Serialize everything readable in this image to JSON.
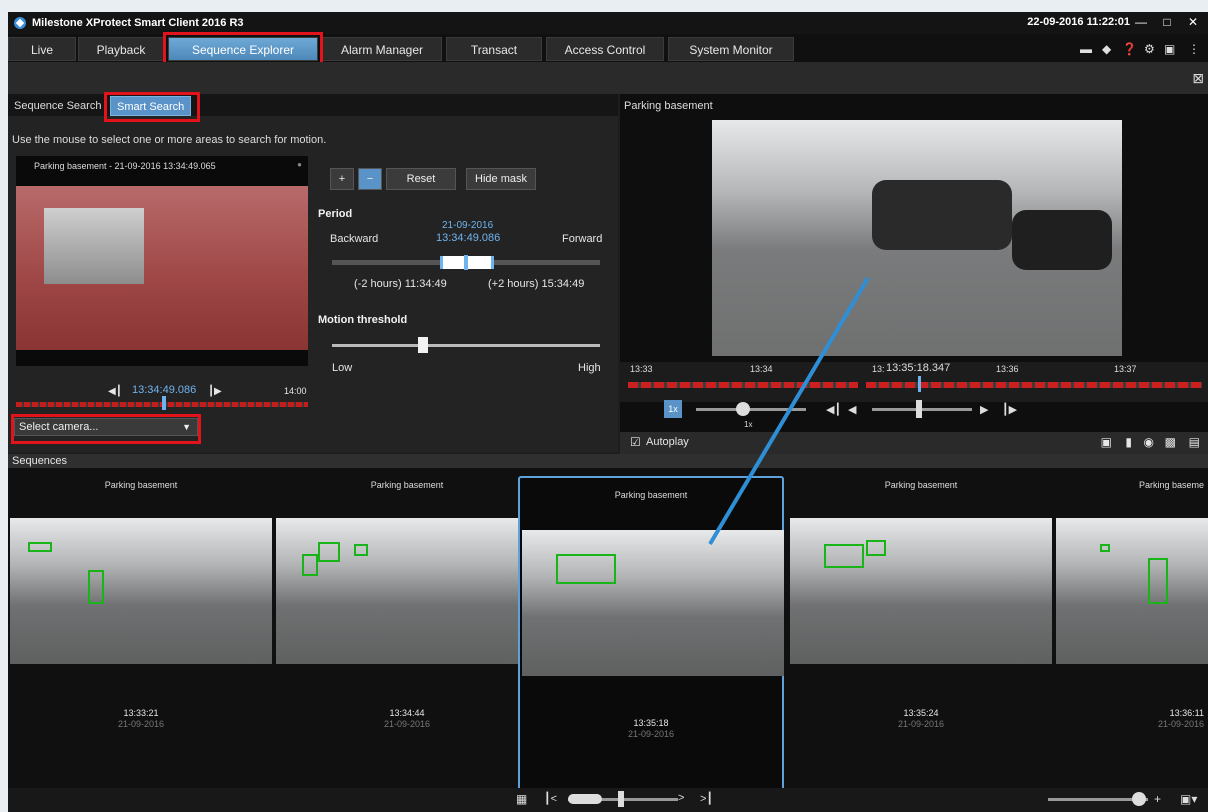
{
  "app": {
    "title": "Milestone XProtect Smart Client 2016 R3",
    "clock": "22-09-2016 11:22:01",
    "window_buttons": {
      "minimize": "—",
      "maximize": "□",
      "close": "✕"
    }
  },
  "tabs": [
    {
      "label": "Live"
    },
    {
      "label": "Playback"
    },
    {
      "label": "Sequence Explorer",
      "active": true
    },
    {
      "label": "Alarm Manager"
    },
    {
      "label": "Transact"
    },
    {
      "label": "Access Control"
    },
    {
      "label": "System Monitor"
    }
  ],
  "search": {
    "tabs": [
      {
        "label": "Sequence Search"
      },
      {
        "label": "Smart Search",
        "active": true
      }
    ],
    "hint": "Use the mouse to select one or more areas to search for motion.",
    "preview_caption": "Parking basement - 21-09-2016 13:34:49.065",
    "reset_label": "Reset",
    "hide_mask_label": "Hide mask",
    "period": {
      "title": "Period",
      "date": "21-09-2016",
      "time": "13:34:49.086",
      "backward": "Backward",
      "forward": "Forward",
      "minus": "(-2 hours) 11:34:49",
      "plus": "(+2 hours) 15:34:49"
    },
    "threshold": {
      "title": "Motion threshold",
      "low": "Low",
      "high": "High"
    },
    "preview_time": "13:34:49.086",
    "preview_end": "14:00",
    "camera_select": "Select camera..."
  },
  "viewer": {
    "title": "Parking basement",
    "ticks": [
      "13:33",
      "13:34",
      "13:",
      "13:36",
      "13:37"
    ],
    "current_time": "13:35:18.347",
    "speed": "1x",
    "speed_label": "1x",
    "autoplay": "Autoplay"
  },
  "sequences": {
    "title": "Sequences",
    "items": [
      {
        "name": "Parking basement",
        "time": "13:33:21",
        "date": "21-09-2016"
      },
      {
        "name": "Parking basement",
        "time": "13:34:44",
        "date": "21-09-2016"
      },
      {
        "name": "Parking basement",
        "time": "13:35:18",
        "date": "21-09-2016",
        "selected": true
      },
      {
        "name": "Parking basement",
        "time": "13:35:24",
        "date": "21-09-2016"
      },
      {
        "name": "Parking baseme",
        "time": "13:36:11",
        "date": "21-09-2016"
      }
    ]
  },
  "colors": {
    "accent": "#5a93c7",
    "highlight_box": "#e2131b",
    "motion_box": "#19b419",
    "timeline_red": "#c81b1b"
  }
}
